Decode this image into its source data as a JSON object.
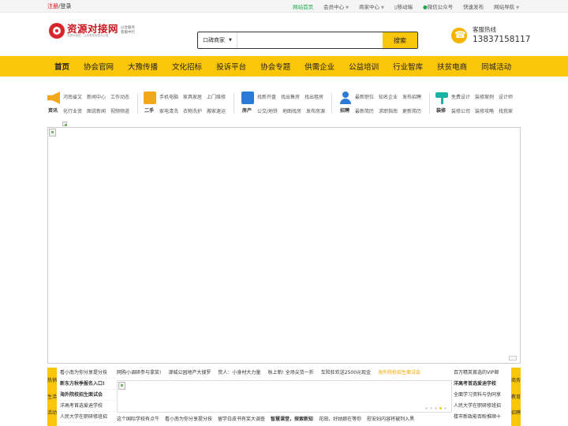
{
  "topbar": {
    "register": "注册",
    "separator": "/",
    "login": "登录",
    "links": [
      {
        "label": "网站首页",
        "active": true,
        "dropdown": false
      },
      {
        "label": "会员中心",
        "active": false,
        "dropdown": true
      },
      {
        "label": "商家中心",
        "active": false,
        "dropdown": true
      },
      {
        "label": "移动端",
        "active": false,
        "dropdown": false
      },
      {
        "label": "微信公众号",
        "active": false,
        "dropdown": false
      },
      {
        "label": "快速发布",
        "active": false,
        "dropdown": false
      },
      {
        "label": "网站导航",
        "active": false,
        "dropdown": true
      }
    ]
  },
  "header": {
    "logo_title": "资源对接网",
    "logo_sub": "资源对接网 · 让资源发挥更大价值",
    "logo_tag": "以合服务 客服中行",
    "search": {
      "category": "口碑商家",
      "placeholder": "",
      "button": "搜索"
    },
    "hotline_label": "客服热线",
    "hotline_number": "13837158117"
  },
  "nav": [
    "首页",
    "协会官网",
    "大豫传播",
    "文化招标",
    "投诉平台",
    "协会专题",
    "供需企业",
    "公益培训",
    "行业智库",
    "扶贫电商",
    "同城活动"
  ],
  "services": [
    {
      "label": "资讯",
      "icon": "megaphone-icon",
      "row1": [
        "河南省文",
        "新闻中心",
        "工作动态"
      ],
      "row2": [
        "化行业资",
        "图说新闻",
        "视频频道"
      ]
    },
    {
      "label": "二手",
      "icon": "box-icon",
      "row1": [
        "手机电脑",
        "家具家居",
        "上门维修"
      ],
      "row2": [
        "家电清洗",
        "衣物洗护",
        "搬家速运"
      ]
    },
    {
      "label": "房产",
      "icon": "document-icon",
      "row1": [
        "找新开盘",
        "找出售房",
        "找出租房"
      ],
      "row2": [
        "公交/地铁",
        "地图找房",
        "发布房源"
      ]
    },
    {
      "label": "招聘",
      "icon": "user-icon",
      "row1": [
        "最新职位",
        "知名企业",
        "发布招聘"
      ],
      "row2": [
        "最新简历",
        "求职指南",
        "更新简历"
      ]
    },
    {
      "label": "装修",
      "icon": "paint-roller-icon",
      "row1": [
        "免费设计",
        "装修案例",
        "设计师"
      ],
      "row2": [
        "装修公司",
        "装修攻略",
        "找我家"
      ]
    }
  ],
  "bottom": {
    "left_tab": [
      "热销",
      "生活",
      "活动"
    ],
    "right_tab": [
      "商务",
      "教育",
      "招聘"
    ],
    "col1": [
      {
        "text": "看小南为你分享提分技",
        "bold": false
      },
      {
        "text": "新东方秋季报名入口!",
        "bold": true
      },
      {
        "text": "海外院校招生面试会",
        "bold": true
      },
      {
        "text": "洋高考首选爱迪学校",
        "bold": false
      },
      {
        "text": "人民大学在职研修班招",
        "bold": false
      }
    ],
    "midtop": [
      {
        "text": "网购小调研参与拿奖!",
        "highlight": false
      },
      {
        "text": "津城公园地产大搜罗",
        "highlight": false
      },
      {
        "text": "贽人：小身材大力量",
        "highlight": false
      },
      {
        "text": "秋上新! 全场尖货一折",
        "highlight": false
      },
      {
        "text": "车险狂欢送2500元现金",
        "highlight": false
      },
      {
        "text": "海外院校招生面试会",
        "highlight": true
      }
    ],
    "midbot": [
      {
        "text": "这个国际学校有点牛",
        "bold": false
      },
      {
        "text": "看小南为你分享提分技",
        "bold": false
      },
      {
        "text": "留学白皮书有奖大调查",
        "bold": false
      },
      {
        "text": "智慧课堂，探索新知",
        "bold": true
      },
      {
        "text": "花田，好姑娘在等你",
        "bold": false
      },
      {
        "text": "慰安妇内容将被列入黑",
        "bold": false
      }
    ],
    "col3": [
      {
        "text": "百万精英首选的VIP邮",
        "bold": false
      },
      {
        "text": "洋高考首选爱迪学校",
        "bold": true
      },
      {
        "text": "全面学习资料与伪同享",
        "bold": false
      },
      {
        "text": "人民大学在职研修班招",
        "bold": false
      },
      {
        "text": "楼市新政能否盼推顺十",
        "bold": false
      }
    ]
  },
  "colors": {
    "accent": "#f9c609",
    "brand_red": "#c9161e",
    "active_green": "#1aa64a"
  }
}
